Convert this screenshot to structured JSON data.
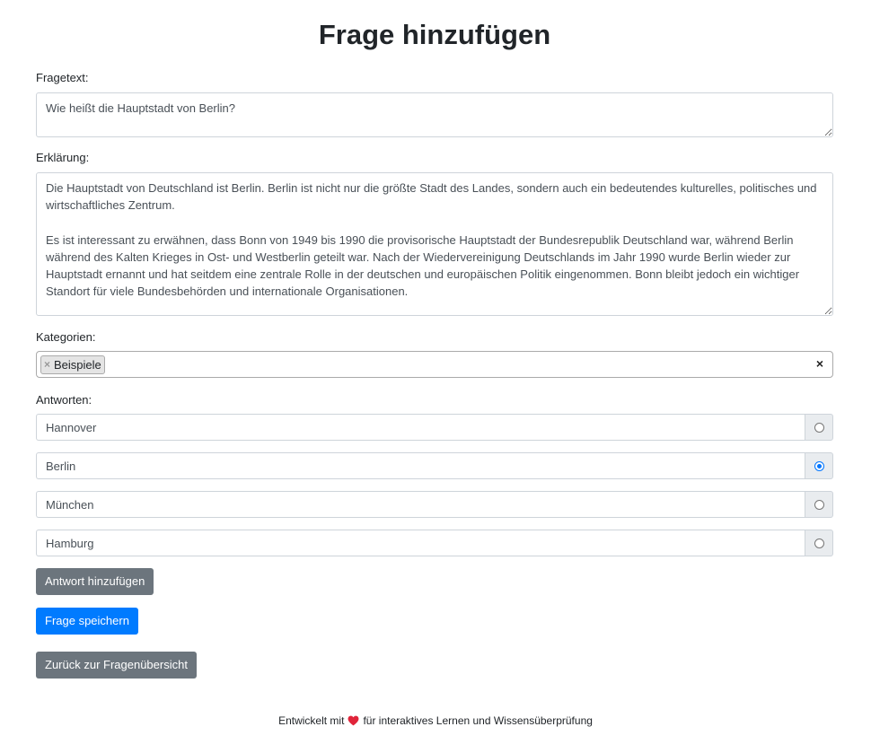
{
  "page": {
    "title": "Frage hinzufügen"
  },
  "form": {
    "question_label": "Fragetext:",
    "question_value": "Wie heißt die Hauptstadt von Berlin?",
    "explanation_label": "Erklärung:",
    "explanation_value": "Die Hauptstadt von Deutschland ist Berlin. Berlin ist nicht nur die größte Stadt des Landes, sondern auch ein bedeutendes kulturelles, politisches und wirtschaftliches Zentrum.\n\nEs ist interessant zu erwähnen, dass Bonn von 1949 bis 1990 die provisorische Hauptstadt der Bundesrepublik Deutschland war, während Berlin während des Kalten Krieges in Ost- und Westberlin geteilt war. Nach der Wiedervereinigung Deutschlands im Jahr 1990 wurde Berlin wieder zur Hauptstadt ernannt und hat seitdem eine zentrale Rolle in der deutschen und europäischen Politik eingenommen. Bonn bleibt jedoch ein wichtiger Standort für viele Bundesbehörden und internationale Organisationen.",
    "categories_label": "Kategorien:",
    "categories": [
      {
        "label": "Beispiele",
        "remove_glyph": "×"
      }
    ],
    "clear_glyph": "×",
    "answers_label": "Antworten:",
    "answers": [
      {
        "value": "Hannover",
        "correct": false
      },
      {
        "value": "Berlin",
        "correct": true
      },
      {
        "value": "München",
        "correct": false
      },
      {
        "value": "Hamburg",
        "correct": false
      }
    ]
  },
  "buttons": {
    "add_answer": "Antwort hinzufügen",
    "save": "Frage speichern",
    "back": "Zurück zur Fragenübersicht"
  },
  "footer": {
    "before": "Entwickelt mit",
    "icon": "heart-icon",
    "after": "für interaktives Lernen und Wissensüberprüfung"
  },
  "colors": {
    "primary": "#007bff",
    "secondary": "#6c757d",
    "heart": "#e0243a"
  }
}
